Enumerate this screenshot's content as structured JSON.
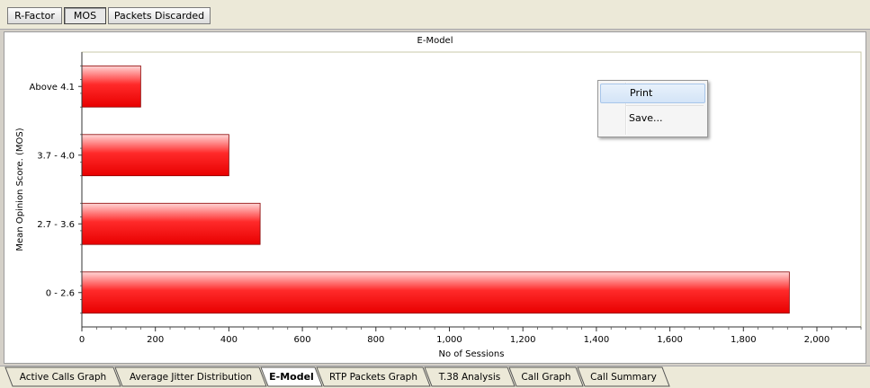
{
  "toolbar": {
    "buttons": [
      {
        "label": "R-Factor",
        "active": false
      },
      {
        "label": "MOS",
        "active": true
      },
      {
        "label": "Packets Discarded",
        "active": false
      }
    ]
  },
  "chart_data": {
    "type": "bar",
    "orientation": "horizontal",
    "title": "E-Model",
    "xlabel": "No of Sessions",
    "ylabel": "Mean Opinion Score. (MOS)",
    "categories": [
      "Above 4.1",
      "3.7 - 4.0",
      "2.7 - 3.6",
      "0 - 2.6"
    ],
    "values": [
      160,
      400,
      485,
      1925
    ],
    "xlim": [
      0,
      2120
    ],
    "xticks": [
      0,
      200,
      400,
      600,
      800,
      1000,
      1200,
      1400,
      1600,
      1800,
      2000
    ],
    "xtick_labels": [
      "0",
      "200",
      "400",
      "600",
      "800",
      "1,000",
      "1,200",
      "1,400",
      "1,600",
      "1,800",
      "2,000"
    ],
    "bar_color": "#ee1111",
    "grid": false,
    "legend": "none"
  },
  "context_menu": {
    "items": [
      {
        "label": "Print",
        "highlighted": true
      },
      {
        "label": "Save...",
        "highlighted": false
      }
    ]
  },
  "tabs": [
    {
      "label": "Active Calls Graph",
      "active": false
    },
    {
      "label": "Average Jitter Distribution",
      "active": false
    },
    {
      "label": "E-Model",
      "active": true
    },
    {
      "label": "RTP Packets Graph",
      "active": false
    },
    {
      "label": "T.38 Analysis",
      "active": false
    },
    {
      "label": "Call Graph",
      "active": false
    },
    {
      "label": "Call Summary",
      "active": false
    }
  ]
}
